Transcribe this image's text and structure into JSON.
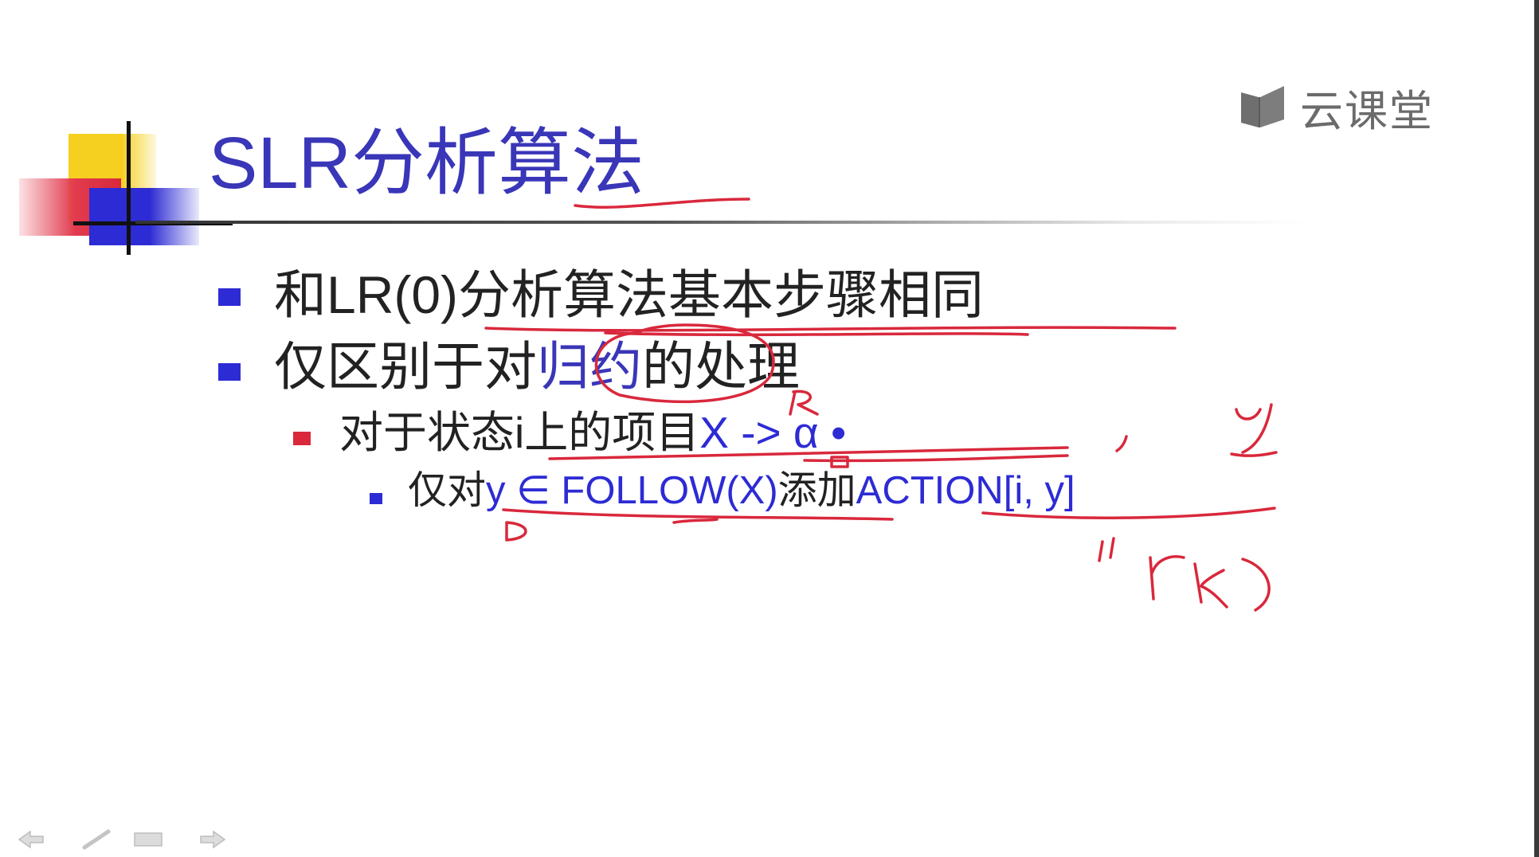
{
  "slide": {
    "title": "SLR分析算法",
    "bullets": [
      {
        "text": "和LR(0)分析算法基本步骤相同"
      },
      {
        "prefix": "仅区别于对",
        "highlight": "归约",
        "suffix": "的处理"
      }
    ],
    "sub_bullet": {
      "prefix": "对于状态i上的项目",
      "highlight": "X -> α •"
    },
    "sub_sub_bullet": {
      "prefix": "仅对",
      "condition": "y ∈ FOLLOW(X)",
      "middle": "添加",
      "action": "ACTION[i, y]"
    }
  },
  "watermark": {
    "text": "云课堂",
    "icon": "cloud-classroom-logo-icon"
  },
  "annotations": {
    "color": "#d9283c",
    "handwriting": [
      "R",
      "y",
      "\"rk)"
    ]
  },
  "nav_icons": [
    "back-arrow-icon",
    "pen-icon",
    "menu-icon",
    "forward-arrow-icon"
  ],
  "colors": {
    "title": "#3a36b8",
    "bullet_blue": "#2d2bd4",
    "bullet_red": "#d9283c",
    "ink": "#d9283c"
  }
}
